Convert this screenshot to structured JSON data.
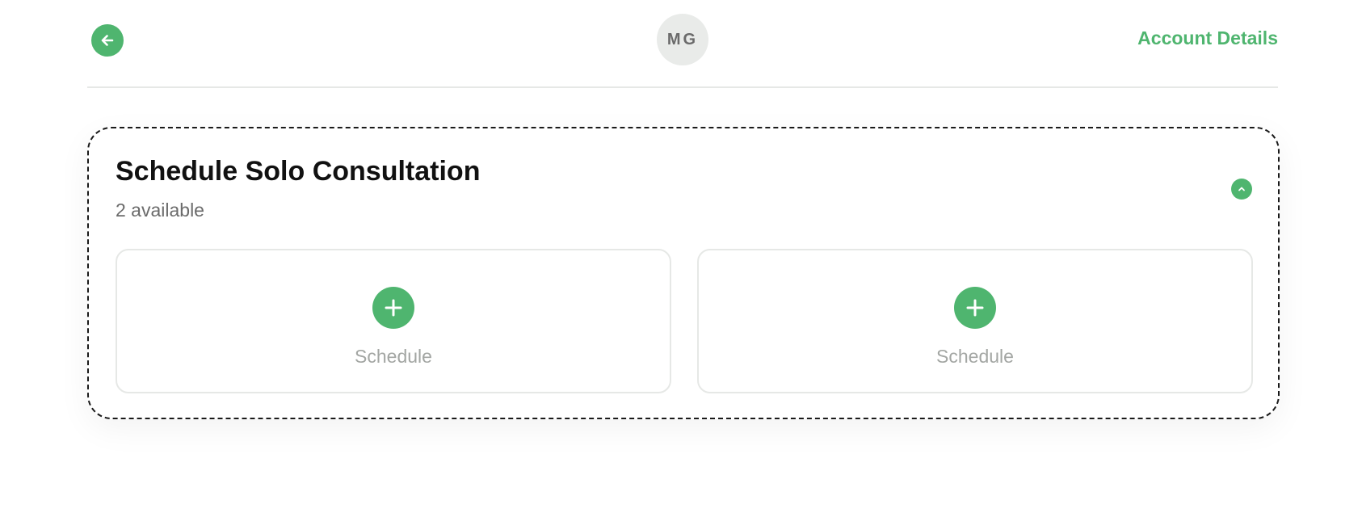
{
  "header": {
    "avatar_initials": "MG",
    "account_link": "Account Details"
  },
  "card": {
    "title": "Schedule Solo Consultation",
    "subtitle": "2 available",
    "slots": [
      {
        "label": "Schedule"
      },
      {
        "label": "Schedule"
      }
    ]
  },
  "colors": {
    "accent": "#4fb56f",
    "border": "#e6e8e6",
    "muted_text": "#a3a6a3"
  },
  "icons": {
    "back": "arrow-left-icon",
    "collapse": "chevron-up-icon",
    "add": "plus-icon"
  }
}
